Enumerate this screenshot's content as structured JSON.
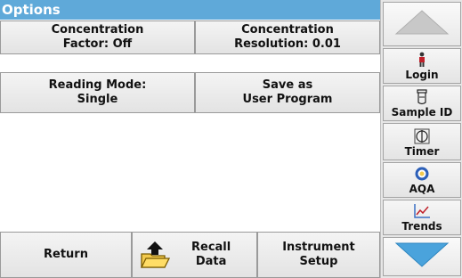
{
  "title": "Options",
  "buttons": {
    "concentration_factor": [
      "Concentration",
      "Factor: Off"
    ],
    "concentration_resolution": [
      "Concentration",
      "Resolution: 0.01"
    ],
    "reading_mode": [
      "Reading Mode:",
      "Single"
    ],
    "save_user_program": [
      "Save as",
      "User Program"
    ]
  },
  "bottom": {
    "return_label": "Return",
    "recall_data": [
      "Recall",
      "Data"
    ],
    "instrument_setup": [
      "Instrument",
      "Setup"
    ]
  },
  "sidebar": {
    "items": [
      {
        "label": "Login",
        "icon": "person-icon"
      },
      {
        "label": "Sample ID",
        "icon": "vial-icon"
      },
      {
        "label": "Timer",
        "icon": "timer-icon"
      },
      {
        "label": "AQA",
        "icon": "aqa-icon"
      },
      {
        "label": "Trends",
        "icon": "trends-icon"
      }
    ]
  },
  "colors": {
    "title_bar": "#5fa9d9",
    "arrow_up": "#c8c8c8",
    "arrow_down": "#4aa3dc"
  }
}
